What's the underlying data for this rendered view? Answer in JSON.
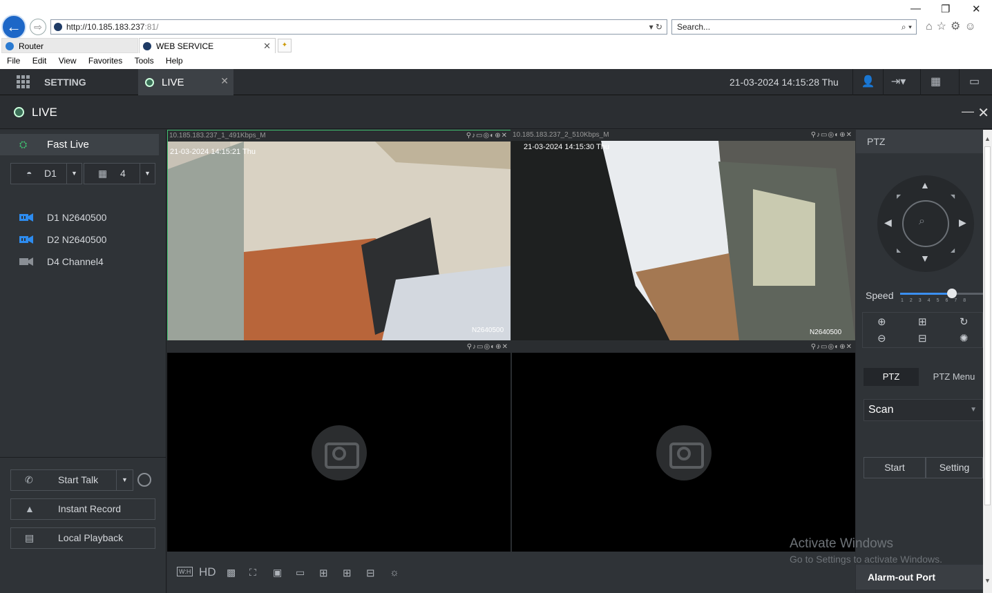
{
  "browser": {
    "url_host": "http://10.185.183.237",
    "url_port": ":81/",
    "search_placeholder": "Search...",
    "tabs": [
      {
        "label": "Router"
      },
      {
        "label": "WEB SERVICE"
      }
    ],
    "menu": [
      "File",
      "Edit",
      "View",
      "Favorites",
      "Tools",
      "Help"
    ]
  },
  "topbar": {
    "setting_label": "SETTING",
    "live_tab_label": "LIVE",
    "datetime": "21-03-2024 14:15:28 Thu"
  },
  "panel_title": "LIVE",
  "left": {
    "fast_live": "Fast Live",
    "device_select": "D1",
    "layout_select": "4",
    "devices": [
      {
        "label": "D1 N2640500",
        "active": true
      },
      {
        "label": "D2 N2640500",
        "active": true
      },
      {
        "label": "D4 Channel4",
        "active": false
      }
    ],
    "start_talk": "Start Talk",
    "instant_record": "Instant Record",
    "local_playback": "Local Playback"
  },
  "video": {
    "panes": [
      {
        "header": "10.185.183.237_1_491Kbps_M",
        "osd_time": "21-03-2024 14:15:21 Thu",
        "osd_name": "N2640500"
      },
      {
        "header": "10.185.183.237_2_510Kbps_M",
        "osd_time": "21-03-2024 14:15:30 Thu",
        "osd_name": "N2640500"
      },
      {
        "header": ""
      },
      {
        "header": ""
      }
    ],
    "toolbar": {
      "wh": "W:H",
      "hd": "HD"
    }
  },
  "ptz": {
    "header": "PTZ",
    "speed_label": "Speed",
    "speed_value": 6,
    "speed_ticks": "12345678",
    "tab_ptz": "PTZ",
    "tab_menu": "PTZ Menu",
    "mode": "Scan",
    "start": "Start",
    "setting": "Setting",
    "alarm_out": "Alarm-out Port"
  },
  "watermark": {
    "line1": "Activate Windows",
    "line2": "Go to Settings to activate Windows."
  },
  "colors": {
    "accent": "#3b8ff0",
    "active_green": "#3fbf6f",
    "device_blue": "#2d8cf0"
  }
}
